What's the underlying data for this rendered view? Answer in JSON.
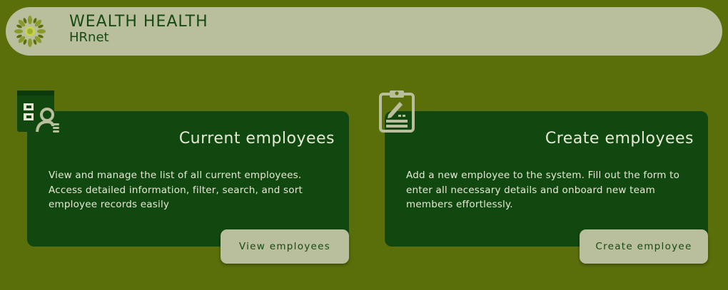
{
  "header": {
    "logo_icon": "leaf-wreath-logo-icon",
    "title": "WEALTH HEALTH",
    "subtitle": "HRnet"
  },
  "cards": [
    {
      "icon": "employee-list-icon",
      "title": "Current employees",
      "description": "View and manage the list of all current employees. Access detailed information, filter, search, and sort employee records easily",
      "button_label": "View employees"
    },
    {
      "icon": "clipboard-edit-icon",
      "title": "Create employees",
      "description": "Add a new employee to the system. Fill out the form to enter all necessary details and onboard new team members effortlessly.",
      "button_label": "Create employee"
    }
  ],
  "colors": {
    "background": "#5a6e0a",
    "header_bg": "#b9be9c",
    "card_bg": "#114810",
    "brand_text": "#174a12",
    "card_text": "#e6e9d6"
  }
}
